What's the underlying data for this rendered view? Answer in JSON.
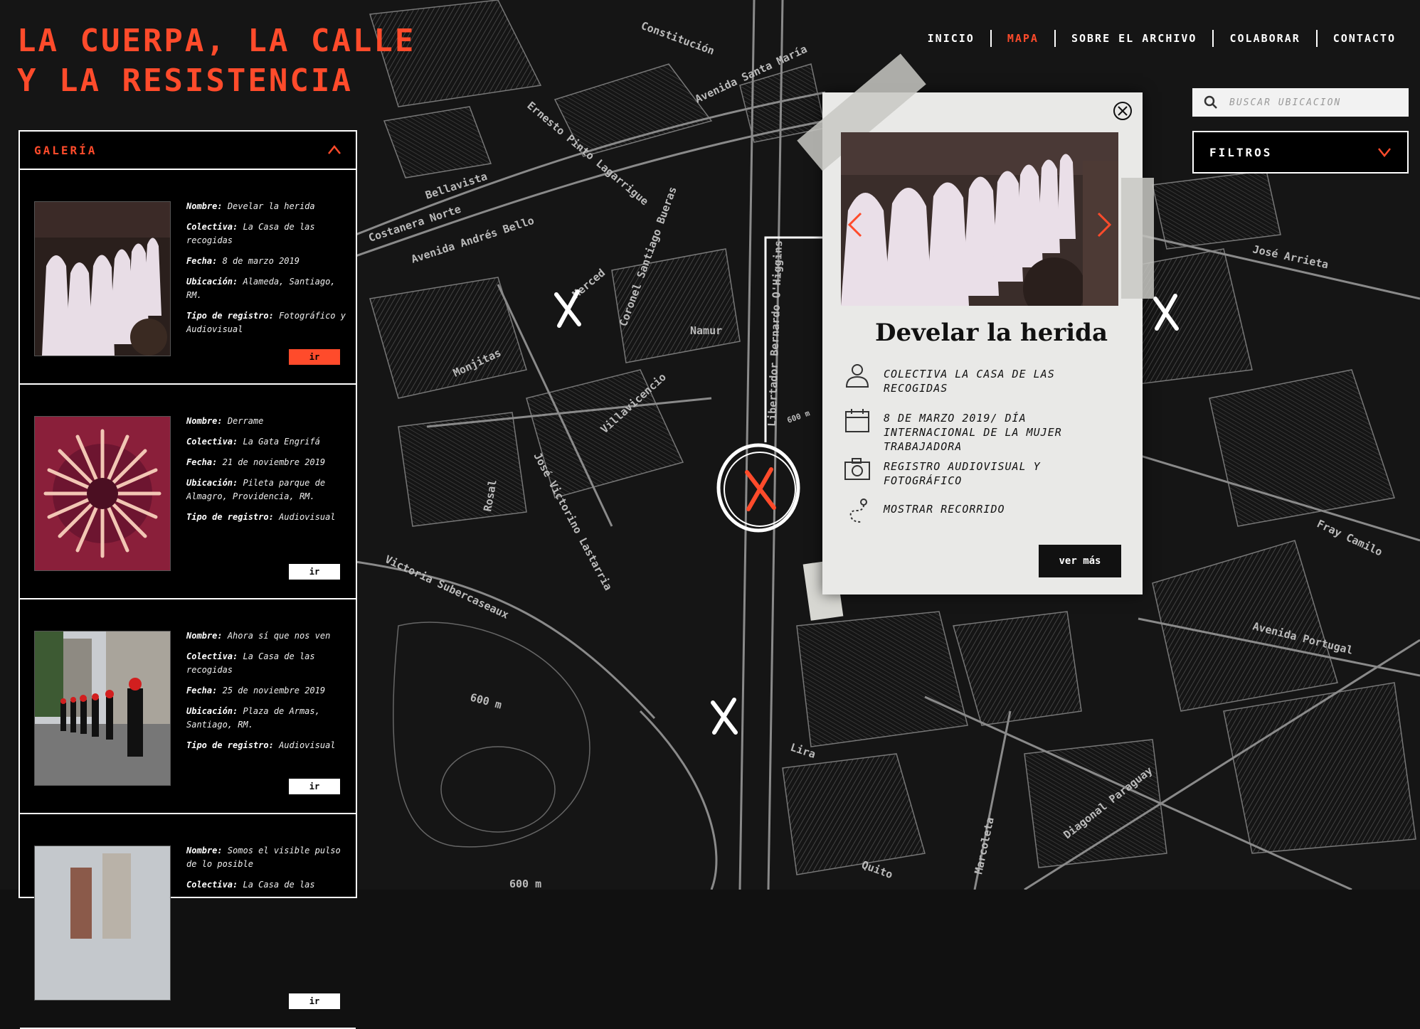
{
  "site": {
    "title_line1": "LA CUERPA, LA CALLE",
    "title_line2": "Y LA RESISTENCIA"
  },
  "nav": {
    "items": [
      {
        "label": "INICIO",
        "active": false
      },
      {
        "label": "MAPA",
        "active": true
      },
      {
        "label": "SOBRE EL ARCHIVO",
        "active": false
      },
      {
        "label": "COLABORAR",
        "active": false
      },
      {
        "label": "CONTACTO",
        "active": false
      }
    ]
  },
  "search": {
    "placeholder": "BUSCAR UBICACIÓN",
    "icon": "search-icon"
  },
  "filters": {
    "label": "FILTROS",
    "icon": "chevron-down-icon"
  },
  "gallery": {
    "title": "GALERÍA",
    "items": [
      {
        "nombre_label": "Nombre:",
        "nombre": "Develar la herida",
        "colectiva_label": "Colectiva:",
        "colectiva": "La Casa de las recogidas",
        "fecha_label": "Fecha:",
        "fecha": "8 de marzo 2019",
        "ubicacion_label": "Ubicación:",
        "ubicacion": "Alameda, Santiago, RM.",
        "tipo_label": "Tipo de registro:",
        "tipo": "Fotográfico y Audiovisual",
        "button": "ir"
      },
      {
        "nombre_label": "Nombre:",
        "nombre": "Derrame",
        "colectiva_label": "Colectiva:",
        "colectiva": "La Gata Engrifá",
        "fecha_label": "Fecha:",
        "fecha": "21 de noviembre 2019",
        "ubicacion_label": "Ubicación:",
        "ubicacion": "Pileta parque de Almagro, Providencia, RM.",
        "tipo_label": "Tipo de registro:",
        "tipo": "Audiovisual",
        "button": "ir"
      },
      {
        "nombre_label": "Nombre:",
        "nombre": "Ahora sí que nos ven",
        "colectiva_label": "Colectiva:",
        "colectiva": "La Casa de las recogidas",
        "fecha_label": "Fecha:",
        "fecha": "25 de noviembre 2019",
        "ubicacion_label": "Ubicación:",
        "ubicacion": "Plaza de Armas, Santiago, RM.",
        "tipo_label": "Tipo de registro:",
        "tipo": "Audiovisual",
        "button": "ir"
      },
      {
        "nombre_label": "Nombre:",
        "nombre": "Somos el visible pulso de lo posible",
        "colectiva_label": "Colectiva:",
        "colectiva": "La Casa de las",
        "button": "ir"
      }
    ]
  },
  "popup": {
    "title": "Develar la herida",
    "colectiva": "COLECTIVA LA CASA DE LAS RECOGIDAS",
    "fecha": "8 DE MARZO 2019/ DÍA INTERNACIONAL DE LA MUJER TRABAJADORA",
    "registro": "REGISTRO AUDIOVISUAL Y FOTOGRÁFICO",
    "recorrido": "MOSTRAR RECORRIDO",
    "button": "ver más"
  },
  "map": {
    "streets": [
      "Costanera Norte",
      "Avenida Andrés Bello",
      "Bellavista",
      "Constitución",
      "Merced",
      "Monjitas",
      "Namur",
      "Villavicencio",
      "José Victorino Lastarria",
      "Victoria Subercaseaux",
      "Libertador Bernardo O'Higgins",
      "Avenida Portugal",
      "Diagonal Paraguay",
      "Marcoleta",
      "Quito",
      "Lira",
      "Fray Camilo",
      "José Arrieta",
      "Avenida Santa María",
      "Rosal",
      "Coronel Santiago Bueras",
      "Ernesto Pinto Lagarrigue"
    ],
    "scale_label": "600 m"
  },
  "colors": {
    "accent": "#ff4b2b",
    "background": "#111111",
    "panel": "#000000",
    "card": "#e9e9e7"
  }
}
